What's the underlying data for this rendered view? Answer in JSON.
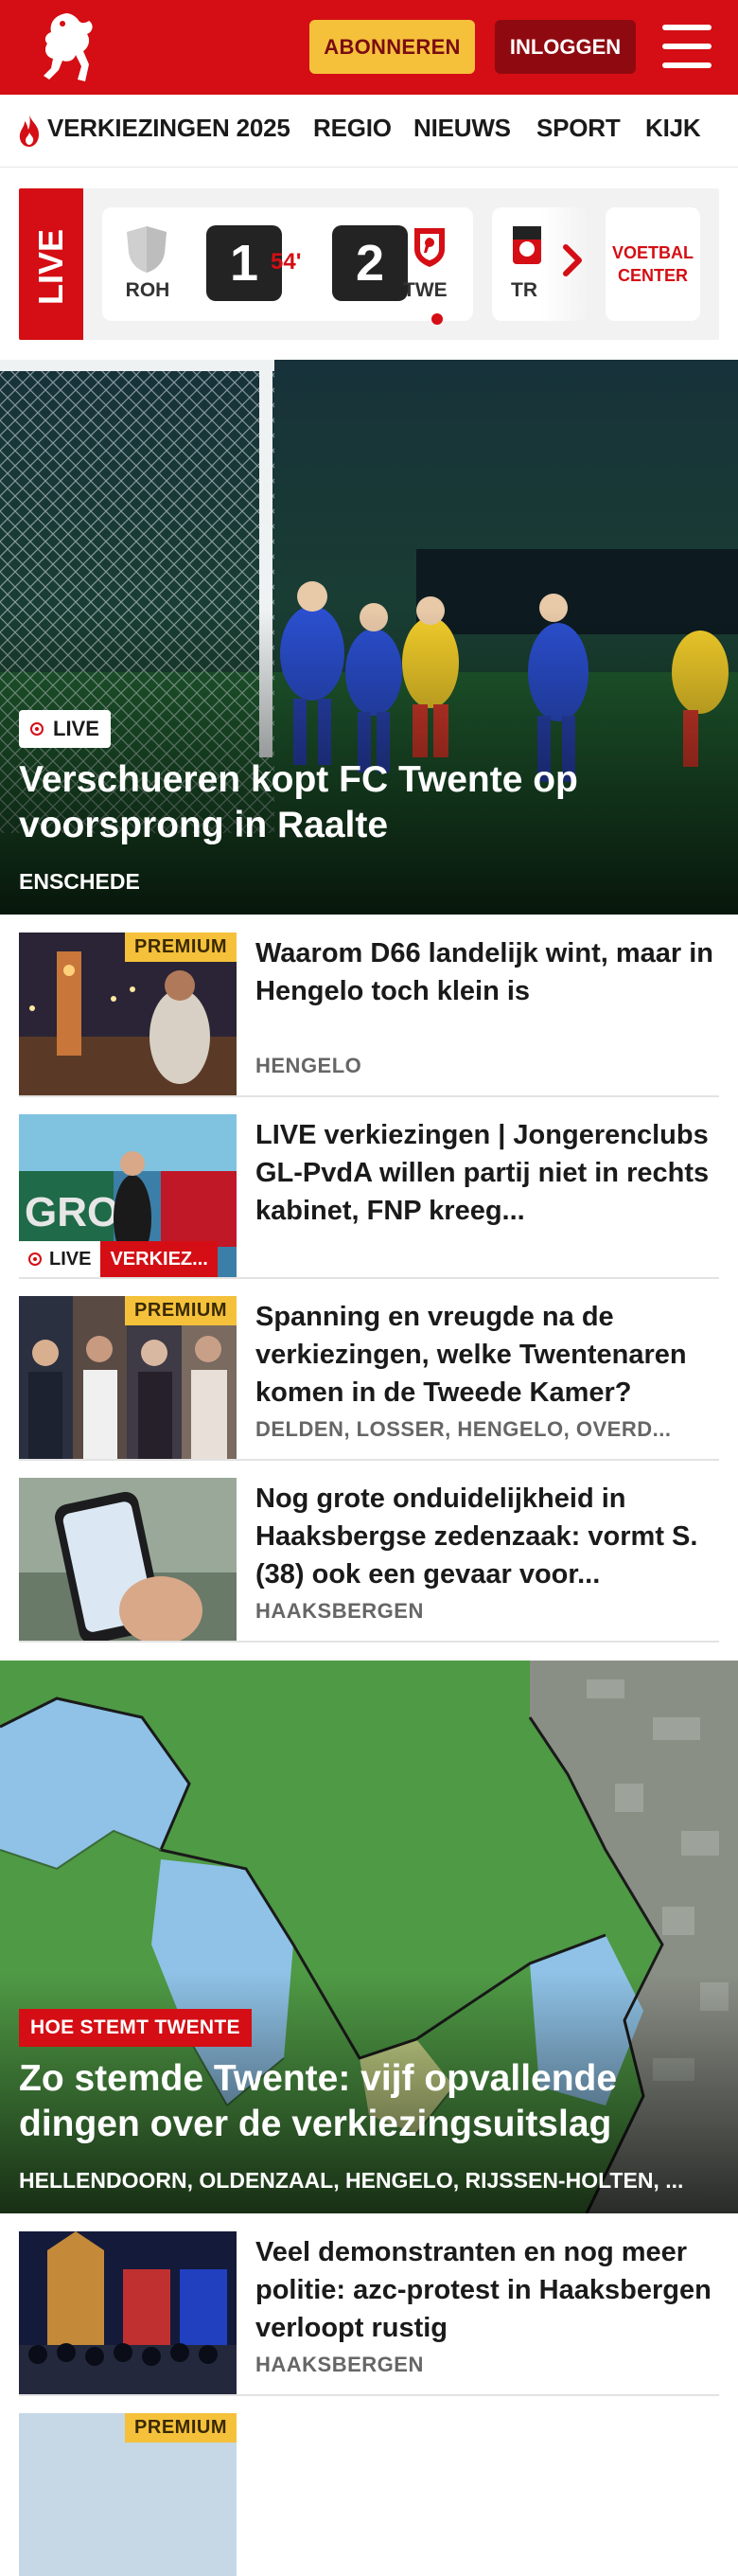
{
  "header": {
    "subscribe_label": "ABONNEREN",
    "login_label": "INLOGGEN",
    "brand_color": "#d40e14",
    "accent_color": "#f5c13b"
  },
  "nav": {
    "items": [
      "VERKIEZINGEN 2025",
      "REGIO",
      "NIEUWS",
      "SPORT",
      "KIJK"
    ]
  },
  "live": {
    "tab_label": "LIVE",
    "match": {
      "home_team": "ROH",
      "home_score": "1",
      "minute": "54'",
      "away_score": "2",
      "away_team": "TWE"
    },
    "next_team": "TR",
    "voetbal_center_label": "VOETBAL CENTER"
  },
  "hero": {
    "badge": "LIVE",
    "title": "Verschueren kopt FC Twente op voorsprong in Raalte",
    "location": "ENSCHEDE"
  },
  "articles": [
    {
      "title": "Waarom D66 landelijk wint, maar in Hengelo toch klein is",
      "location": "HENGELO",
      "premium": "PREMIUM"
    },
    {
      "title": "LIVE verkiezingen | Jongeren­clubs GL-PvdA willen partij niet in rechts kabinet, FNP kreeg...",
      "location": "",
      "live_label": "LIVE",
      "category": "VERKIEZ..."
    },
    {
      "title": "Spanning en vreugde na de verkiezingen, welke Twentena­ren komen in de Tweede Kamer?",
      "location": "DELDEN, LOSSER, HENGELO, OVERD...",
      "premium": "PREMIUM"
    },
    {
      "title": "Nog grote onduidelijkheid in Haaksbergse zedenzaak: vormt S. (38) ook een gevaar voor...",
      "location": "HAAKSBERGEN"
    }
  ],
  "feature": {
    "tag": "HOE STEMT TWENTE",
    "title": "Zo stemde Twente: vijf opvallende dingen over de verkiezingsuitslag",
    "locations": "HELLENDOORN, OLDENZAAL, HENGELO, RIJSSEN-HOLTEN, ..."
  },
  "articles2": [
    {
      "title": "Veel demonstranten en nog meer politie: azc-protest in Haaksber­gen verloopt rustig",
      "location": "HAAKSBERGEN"
    }
  ],
  "partial": {
    "premium": "PREMIUM"
  }
}
